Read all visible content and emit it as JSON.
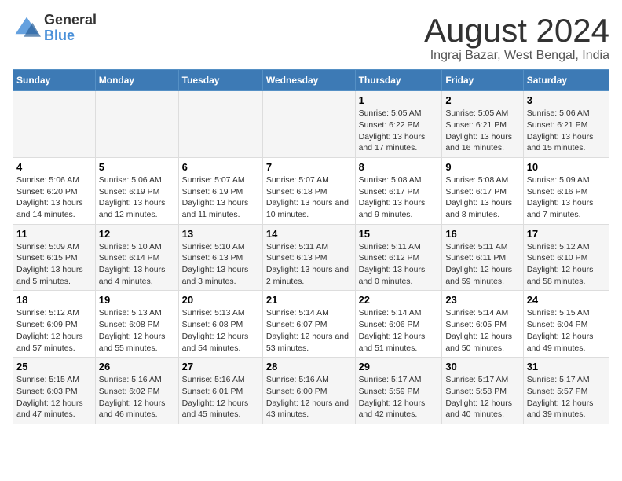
{
  "header": {
    "logo_general": "General",
    "logo_blue": "Blue",
    "title": "August 2024",
    "subtitle": "Ingraj Bazar, West Bengal, India"
  },
  "days_of_week": [
    "Sunday",
    "Monday",
    "Tuesday",
    "Wednesday",
    "Thursday",
    "Friday",
    "Saturday"
  ],
  "weeks": [
    [
      {
        "day": "",
        "sunrise": "",
        "sunset": "",
        "daylight": ""
      },
      {
        "day": "",
        "sunrise": "",
        "sunset": "",
        "daylight": ""
      },
      {
        "day": "",
        "sunrise": "",
        "sunset": "",
        "daylight": ""
      },
      {
        "day": "",
        "sunrise": "",
        "sunset": "",
        "daylight": ""
      },
      {
        "day": "1",
        "sunrise": "5:05 AM",
        "sunset": "6:22 PM",
        "daylight": "13 hours and 17 minutes."
      },
      {
        "day": "2",
        "sunrise": "5:05 AM",
        "sunset": "6:21 PM",
        "daylight": "13 hours and 16 minutes."
      },
      {
        "day": "3",
        "sunrise": "5:06 AM",
        "sunset": "6:21 PM",
        "daylight": "13 hours and 15 minutes."
      }
    ],
    [
      {
        "day": "4",
        "sunrise": "5:06 AM",
        "sunset": "6:20 PM",
        "daylight": "13 hours and 14 minutes."
      },
      {
        "day": "5",
        "sunrise": "5:06 AM",
        "sunset": "6:19 PM",
        "daylight": "13 hours and 12 minutes."
      },
      {
        "day": "6",
        "sunrise": "5:07 AM",
        "sunset": "6:19 PM",
        "daylight": "13 hours and 11 minutes."
      },
      {
        "day": "7",
        "sunrise": "5:07 AM",
        "sunset": "6:18 PM",
        "daylight": "13 hours and 10 minutes."
      },
      {
        "day": "8",
        "sunrise": "5:08 AM",
        "sunset": "6:17 PM",
        "daylight": "13 hours and 9 minutes."
      },
      {
        "day": "9",
        "sunrise": "5:08 AM",
        "sunset": "6:17 PM",
        "daylight": "13 hours and 8 minutes."
      },
      {
        "day": "10",
        "sunrise": "5:09 AM",
        "sunset": "6:16 PM",
        "daylight": "13 hours and 7 minutes."
      }
    ],
    [
      {
        "day": "11",
        "sunrise": "5:09 AM",
        "sunset": "6:15 PM",
        "daylight": "13 hours and 5 minutes."
      },
      {
        "day": "12",
        "sunrise": "5:10 AM",
        "sunset": "6:14 PM",
        "daylight": "13 hours and 4 minutes."
      },
      {
        "day": "13",
        "sunrise": "5:10 AM",
        "sunset": "6:13 PM",
        "daylight": "13 hours and 3 minutes."
      },
      {
        "day": "14",
        "sunrise": "5:11 AM",
        "sunset": "6:13 PM",
        "daylight": "13 hours and 2 minutes."
      },
      {
        "day": "15",
        "sunrise": "5:11 AM",
        "sunset": "6:12 PM",
        "daylight": "13 hours and 0 minutes."
      },
      {
        "day": "16",
        "sunrise": "5:11 AM",
        "sunset": "6:11 PM",
        "daylight": "12 hours and 59 minutes."
      },
      {
        "day": "17",
        "sunrise": "5:12 AM",
        "sunset": "6:10 PM",
        "daylight": "12 hours and 58 minutes."
      }
    ],
    [
      {
        "day": "18",
        "sunrise": "5:12 AM",
        "sunset": "6:09 PM",
        "daylight": "12 hours and 57 minutes."
      },
      {
        "day": "19",
        "sunrise": "5:13 AM",
        "sunset": "6:08 PM",
        "daylight": "12 hours and 55 minutes."
      },
      {
        "day": "20",
        "sunrise": "5:13 AM",
        "sunset": "6:08 PM",
        "daylight": "12 hours and 54 minutes."
      },
      {
        "day": "21",
        "sunrise": "5:14 AM",
        "sunset": "6:07 PM",
        "daylight": "12 hours and 53 minutes."
      },
      {
        "day": "22",
        "sunrise": "5:14 AM",
        "sunset": "6:06 PM",
        "daylight": "12 hours and 51 minutes."
      },
      {
        "day": "23",
        "sunrise": "5:14 AM",
        "sunset": "6:05 PM",
        "daylight": "12 hours and 50 minutes."
      },
      {
        "day": "24",
        "sunrise": "5:15 AM",
        "sunset": "6:04 PM",
        "daylight": "12 hours and 49 minutes."
      }
    ],
    [
      {
        "day": "25",
        "sunrise": "5:15 AM",
        "sunset": "6:03 PM",
        "daylight": "12 hours and 47 minutes."
      },
      {
        "day": "26",
        "sunrise": "5:16 AM",
        "sunset": "6:02 PM",
        "daylight": "12 hours and 46 minutes."
      },
      {
        "day": "27",
        "sunrise": "5:16 AM",
        "sunset": "6:01 PM",
        "daylight": "12 hours and 45 minutes."
      },
      {
        "day": "28",
        "sunrise": "5:16 AM",
        "sunset": "6:00 PM",
        "daylight": "12 hours and 43 minutes."
      },
      {
        "day": "29",
        "sunrise": "5:17 AM",
        "sunset": "5:59 PM",
        "daylight": "12 hours and 42 minutes."
      },
      {
        "day": "30",
        "sunrise": "5:17 AM",
        "sunset": "5:58 PM",
        "daylight": "12 hours and 40 minutes."
      },
      {
        "day": "31",
        "sunrise": "5:17 AM",
        "sunset": "5:57 PM",
        "daylight": "12 hours and 39 minutes."
      }
    ]
  ]
}
